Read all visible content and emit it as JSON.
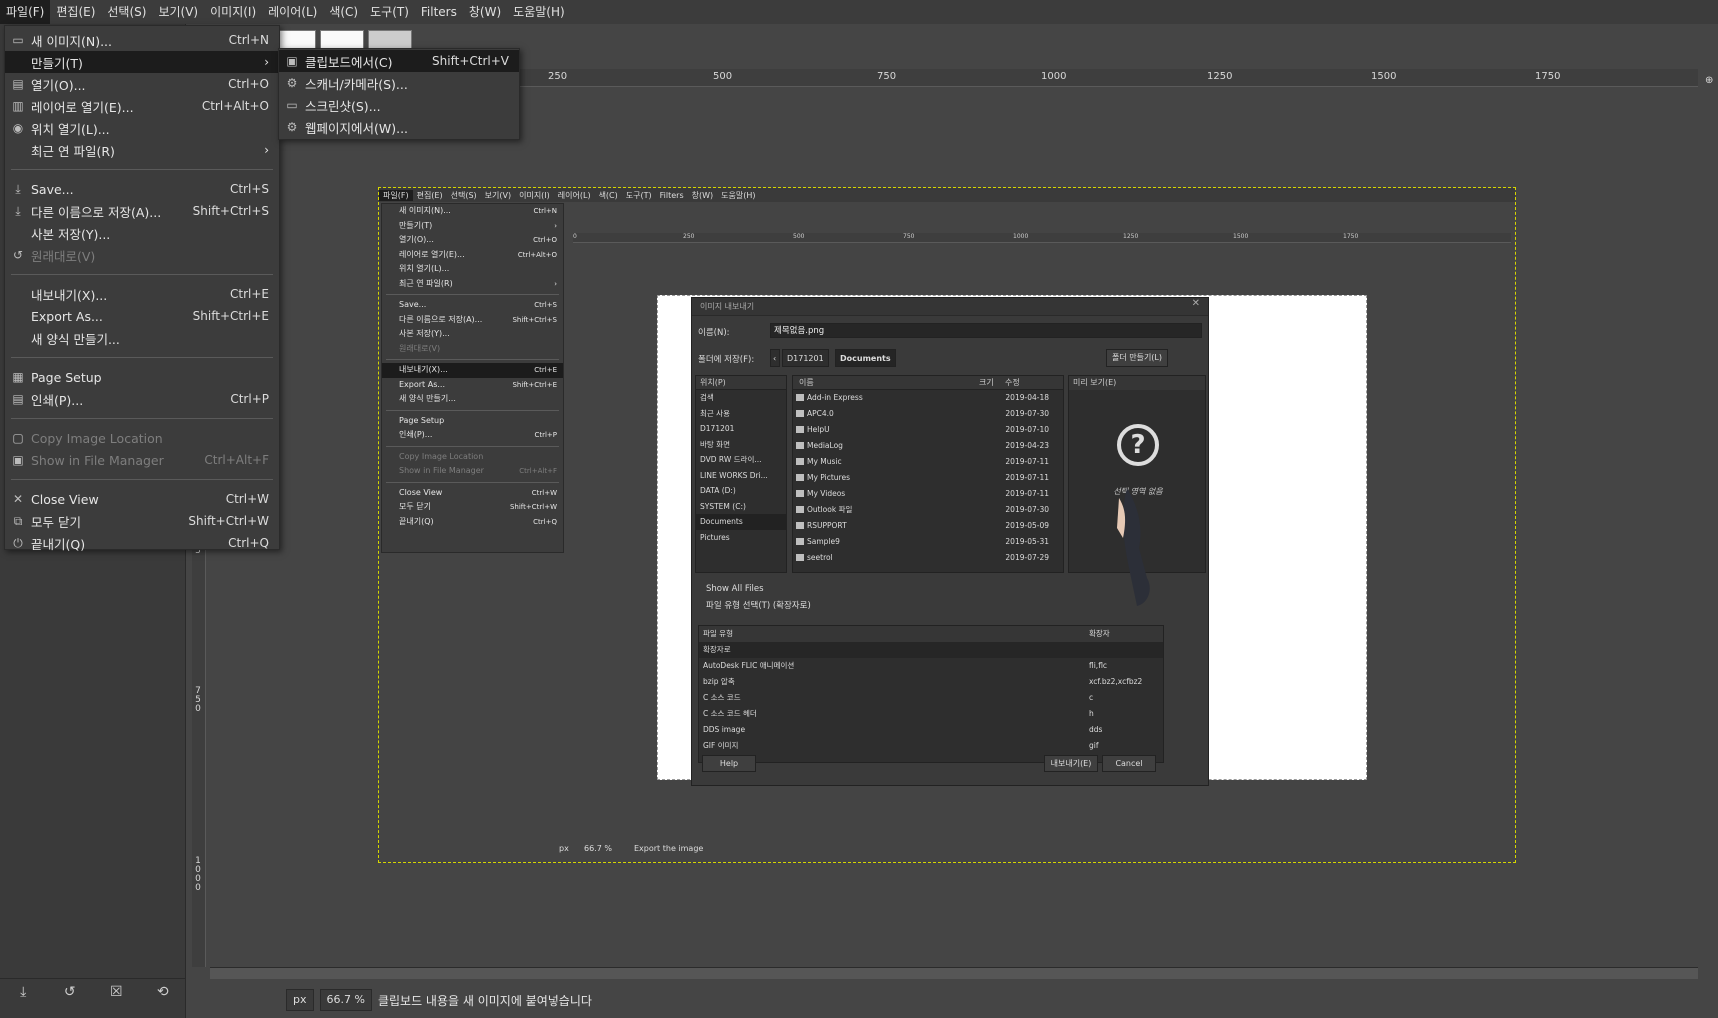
{
  "menubar": {
    "items": [
      "파일(F)",
      "편집(E)",
      "선택(S)",
      "보기(V)",
      "이미지(I)",
      "레이어(L)",
      "색(C)",
      "도구(T)",
      "Filters",
      "창(W)",
      "도움말(H)"
    ]
  },
  "file_menu": {
    "items": [
      {
        "label": "새 이미지(N)...",
        "shortcut": "Ctrl+N",
        "icon": "new-image-icon"
      },
      {
        "label": "만들기(T)",
        "shortcut": "",
        "icon": "",
        "submenu": true
      },
      {
        "label": "열기(O)...",
        "shortcut": "Ctrl+O",
        "icon": "open-icon"
      },
      {
        "label": "레이어로 열기(E)...",
        "shortcut": "Ctrl+Alt+O",
        "icon": "open-as-layers-icon"
      },
      {
        "label": "위치 열기(L)...",
        "shortcut": "",
        "icon": "globe-icon"
      },
      {
        "label": "최근 연 파일(R)",
        "shortcut": "",
        "icon": "",
        "submenu": true
      },
      {
        "label": "Save...",
        "shortcut": "Ctrl+S",
        "icon": "save-icon"
      },
      {
        "label": "다른 이름으로 저장(A)...",
        "shortcut": "Shift+Ctrl+S",
        "icon": "save-as-icon"
      },
      {
        "label": "사본 저장(Y)...",
        "shortcut": "",
        "icon": ""
      },
      {
        "label": "원래대로(V)",
        "shortcut": "",
        "icon": "revert-icon",
        "disabled": true
      },
      {
        "label": "내보내기(X)...",
        "shortcut": "Ctrl+E",
        "icon": ""
      },
      {
        "label": "Export As...",
        "shortcut": "Shift+Ctrl+E",
        "icon": ""
      },
      {
        "label": "새 양식 만들기...",
        "shortcut": "",
        "icon": ""
      },
      {
        "label": "Page Setup",
        "shortcut": "",
        "icon": "page-setup-icon"
      },
      {
        "label": "인쇄(P)...",
        "shortcut": "Ctrl+P",
        "icon": "print-icon"
      },
      {
        "label": "Copy Image Location",
        "shortcut": "",
        "icon": "copy-icon",
        "disabled": true
      },
      {
        "label": "Show in File Manager",
        "shortcut": "Ctrl+Alt+F",
        "icon": "file-manager-icon",
        "disabled": true
      },
      {
        "label": "Close View",
        "shortcut": "Ctrl+W",
        "icon": "close-icon"
      },
      {
        "label": "모두 닫기",
        "shortcut": "Shift+Ctrl+W",
        "icon": "close-all-icon"
      },
      {
        "label": "끝내기(Q)",
        "shortcut": "Ctrl+Q",
        "icon": "quit-icon"
      }
    ]
  },
  "create_submenu": {
    "items": [
      {
        "label": "클립보드에서(C)",
        "shortcut": "Shift+Ctrl+V",
        "icon": "clipboard-icon"
      },
      {
        "label": "스캐너/카메라(S)...",
        "shortcut": "",
        "icon": "scanner-icon"
      },
      {
        "label": "스크린샷(S)...",
        "shortcut": "",
        "icon": "screenshot-icon"
      },
      {
        "label": "웹페이지에서(W)...",
        "shortcut": "",
        "icon": "webpage-icon"
      }
    ]
  },
  "ruler": {
    "h_ticks": [
      "250",
      "500",
      "750",
      "1000",
      "1250",
      "1500",
      "1750"
    ],
    "v_ticks": [
      "5",
      "7\n5\n0",
      "1\n0\n0\n0"
    ]
  },
  "statusbar": {
    "unit": "px",
    "zoom": "66.7 %",
    "message": "클립보드 내용을 새 이미지에 붙여넣습니다"
  },
  "inner": {
    "menubar": [
      "파일(F)",
      "편집(E)",
      "선택(S)",
      "보기(V)",
      "이미지(I)",
      "레이어(L)",
      "색(C)",
      "도구(T)",
      "Filters",
      "창(W)",
      "도움말(H)"
    ],
    "ruler_ticks": [
      "0",
      "250",
      "500",
      "750",
      "1000",
      "1250",
      "1500",
      "1750"
    ],
    "menu_items": [
      {
        "label": "새 이미지(N)...",
        "shortcut": "Ctrl+N"
      },
      {
        "label": "만들기(T)",
        "shortcut": "›"
      },
      {
        "label": "열기(O)...",
        "shortcut": "Ctrl+O"
      },
      {
        "label": "레이어로 열기(E)...",
        "shortcut": "Ctrl+Alt+O"
      },
      {
        "label": "위치 열기(L)...",
        "shortcut": ""
      },
      {
        "label": "최근 연 파일(R)",
        "shortcut": "›"
      },
      {
        "label": "Save...",
        "shortcut": "Ctrl+S"
      },
      {
        "label": "다른 이름으로 저장(A)...",
        "shortcut": "Shift+Ctrl+S"
      },
      {
        "label": "사본 저장(Y)...",
        "shortcut": ""
      },
      {
        "label": "원래대로(V)",
        "shortcut": ""
      },
      {
        "label": "내보내기(X)...",
        "shortcut": "Ctrl+E"
      },
      {
        "label": "Export As...",
        "shortcut": "Shift+Ctrl+E"
      },
      {
        "label": "새 양식 만들기...",
        "shortcut": ""
      },
      {
        "label": "Page Setup",
        "shortcut": ""
      },
      {
        "label": "인쇄(P)...",
        "shortcut": "Ctrl+P"
      },
      {
        "label": "Copy Image Location",
        "shortcut": ""
      },
      {
        "label": "Show in File Manager",
        "shortcut": "Ctrl+Alt+F"
      },
      {
        "label": "Close View",
        "shortcut": "Ctrl+W"
      },
      {
        "label": "모두 닫기",
        "shortcut": "Shift+Ctrl+W"
      },
      {
        "label": "끝내기(Q)",
        "shortcut": "Ctrl+Q"
      }
    ],
    "status_unit": "px",
    "status_zoom": "66.7 %",
    "status_msg": "Export the image"
  },
  "dialog": {
    "title": "이미지 내보내기",
    "name_label": "이름(N):",
    "name_value": "제목없음.png",
    "folder_label": "폴더에 저장(F):",
    "crumbs": [
      "D171201",
      "Documents"
    ],
    "new_folder": "폴더 만들기(L)",
    "places_header": "위치(P)",
    "places": [
      "검색",
      "최근 사용",
      "D171201",
      "바탕 화면",
      "DVD RW 드라이...",
      "LINE WORKS Dri...",
      "DATA (D:)",
      "SYSTEM (C:)",
      "Documents",
      "Pictures"
    ],
    "col_name": "이름",
    "col_size": "크기",
    "col_modified": "수정",
    "files": [
      {
        "name": "Add-in Express",
        "date": "2019-04-18"
      },
      {
        "name": "APC4.0",
        "date": "2019-07-30"
      },
      {
        "name": "HelpU",
        "date": "2019-07-10"
      },
      {
        "name": "MediaLog",
        "date": "2019-04-23"
      },
      {
        "name": "My Music",
        "date": "2019-07-11"
      },
      {
        "name": "My Pictures",
        "date": "2019-07-11"
      },
      {
        "name": "My Videos",
        "date": "2019-07-11"
      },
      {
        "name": "Outlook 파일",
        "date": "2019-07-30"
      },
      {
        "name": "RSUPPORT",
        "date": "2019-05-09"
      },
      {
        "name": "Sample9",
        "date": "2019-05-31"
      },
      {
        "name": "seetrol",
        "date": "2019-07-29"
      }
    ],
    "preview_header": "미리 보기(E)",
    "no_selection": "선택 영역 없음",
    "show_all": "Show All Files",
    "filetype_toggle": "파일 유형 선택(T) (확장자로)",
    "ft_col_type": "파일 유형",
    "ft_col_ext": "확장자",
    "filetypes": [
      {
        "type": "확장자로",
        "ext": ""
      },
      {
        "type": "AutoDesk FLIC 애니메이션",
        "ext": "fli,flc"
      },
      {
        "type": "bzip 압축",
        "ext": "xcf.bz2,xcfbz2"
      },
      {
        "type": "C 소스 코드",
        "ext": "c"
      },
      {
        "type": "C 소스 코드 헤더",
        "ext": "h"
      },
      {
        "type": "DDS image",
        "ext": "dds"
      },
      {
        "type": "GIF 이미지",
        "ext": "gif"
      }
    ],
    "help": "Help",
    "export": "내보내기(E)",
    "cancel": "Cancel"
  }
}
